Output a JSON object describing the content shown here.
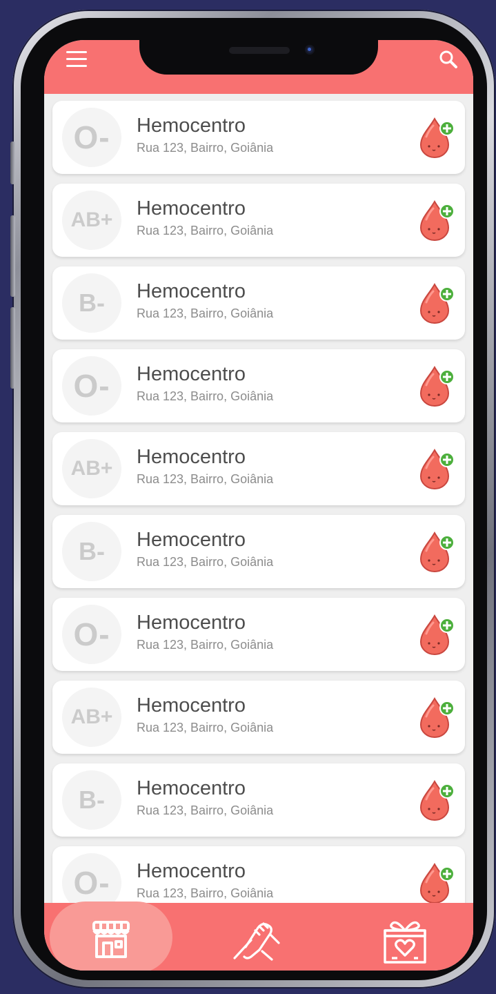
{
  "colors": {
    "accent": "#f87171",
    "background": "#2b2d62",
    "card": "#ffffff",
    "blood_type_text": "#cbcbcb",
    "add_badge": "#4caf3c"
  },
  "header": {
    "menu_icon": "hamburger-menu-icon",
    "search_icon": "search-icon"
  },
  "centers": [
    {
      "blood_type": "O-",
      "name": "Hemocentro",
      "address": "Rua 123, Bairro, Goiânia"
    },
    {
      "blood_type": "AB+",
      "name": "Hemocentro",
      "address": "Rua 123, Bairro, Goiânia"
    },
    {
      "blood_type": "B-",
      "name": "Hemocentro",
      "address": "Rua 123, Bairro, Goiânia"
    },
    {
      "blood_type": "O-",
      "name": "Hemocentro",
      "address": "Rua 123, Bairro, Goiânia"
    },
    {
      "blood_type": "AB+",
      "name": "Hemocentro",
      "address": "Rua 123, Bairro, Goiânia"
    },
    {
      "blood_type": "B-",
      "name": "Hemocentro",
      "address": "Rua 123, Bairro, Goiânia"
    },
    {
      "blood_type": "O-",
      "name": "Hemocentro",
      "address": "Rua 123, Bairro, Goiânia"
    },
    {
      "blood_type": "AB+",
      "name": "Hemocentro",
      "address": "Rua 123, Bairro, Goiânia"
    },
    {
      "blood_type": "B-",
      "name": "Hemocentro",
      "address": "Rua 123, Bairro, Goiânia"
    },
    {
      "blood_type": "O-",
      "name": "Hemocentro",
      "address": "Rua 123, Bairro, Goiânia"
    }
  ],
  "card_action_icon": "blood-drop-add-icon",
  "bottom_nav": {
    "active": "centers",
    "items": [
      {
        "id": "centers",
        "icon": "store-front-icon"
      },
      {
        "id": "donate",
        "icon": "handshake-icon"
      },
      {
        "id": "rewards",
        "icon": "gift-heart-icon"
      }
    ]
  }
}
